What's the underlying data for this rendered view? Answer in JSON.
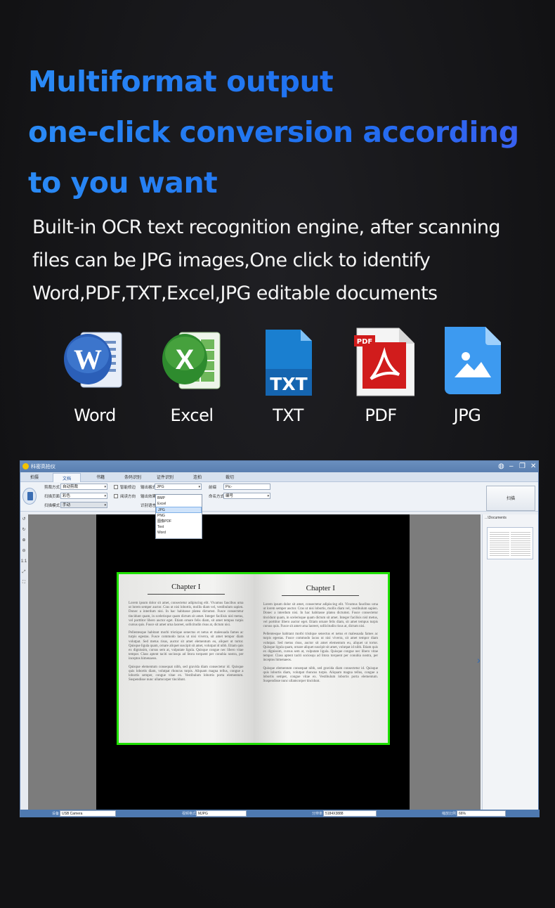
{
  "headline": {
    "line1": "Multiformat output",
    "line2": "one-click conversion according",
    "line3": "to you want"
  },
  "description": {
    "line1": "Built-in OCR text recognition engine, after scanning",
    "line2": "files can be JPG images,One click to identify",
    "line3": "Word,PDF,TXT,Excel,JPG editable documents"
  },
  "formats": [
    {
      "label": "Word",
      "icon": "word-icon",
      "color": "#2b5fb8"
    },
    {
      "label": "Excel",
      "icon": "excel-icon",
      "color": "#2e8b2e"
    },
    {
      "label": "TXT",
      "icon": "txt-icon",
      "color": "#1a7fd0",
      "glyph": "TXT"
    },
    {
      "label": "PDF",
      "icon": "pdf-icon",
      "color": "#d11c1c",
      "glyph": "PDF"
    },
    {
      "label": "JPG",
      "icon": "jpg-icon",
      "color": "#3d9af0"
    }
  ],
  "app": {
    "title": "科密高拍仪",
    "tabs": [
      "拍摄",
      "文档",
      "书籍",
      "条码识别",
      "证件识别",
      "连拍",
      "裁切"
    ],
    "active_tab": "文档",
    "ribbon": {
      "crop_label": "剪裁方式",
      "crop_value": "自动剪裁",
      "color_label": "扫描页面",
      "color_value": "彩色",
      "mode_label": "扫描模式",
      "mode_value": "手动",
      "smart_label": "智能修边",
      "rotate_label": "阅读方向",
      "output_label": "输出格式",
      "output_value": "JPG",
      "effect_label": "输出效果",
      "lang_label": "识别语言",
      "prefix_label": "前缀",
      "prefix_value": "Pic-",
      "naming_label": "命名方式",
      "naming_value": "编号"
    },
    "format_options": [
      "BMP",
      "Excel",
      "JPG",
      "PNG",
      "图像PDF",
      "Text",
      "Word"
    ],
    "selected_format": "JPG",
    "scan_button": "扫描",
    "side_panel_title": "...\\Documents",
    "left_tools": [
      "↺",
      "↻",
      "⊕",
      "⊖",
      "1:1",
      "⤢",
      "⛶"
    ],
    "book": {
      "left_heading": "Chapter I",
      "right_heading": "Chapter I",
      "para1": "Lorem ipsum dolor sit amet, consectetur adipiscing elit. Vivamus faucibus urna ut lorem semper auctor. Cras ut nisi lobortis, mollis diam vel, vestibulum sapien. Donec a interdum nisi. In hac habitasse platea dictumst. Fusce consectetur tincidunt quam, in scelerisque quam dictum sit amet. Integer facilisis nisl metus, vel porttitor libero auctor eget. Etiam ornare felis diam, sit amet tempus turpis cursus quis. Fusce sit amet urna laoreet, sollicitudin risus at, dictum nisi.",
      "para2": "Pellentesque habitant morbi tristique senectus et netus et malesuada fames ac turpis egestas. Fusce commodo lacus ut nisi viverra, sit amet tempor diam volutpat. Sed metus risus, auctor sit amet elementum eu, aliquet ut tortor. Quisque ligula quam, ornare aliquet suscipit sit amet, volutpat id nibh. Etiam quis ex dignissim, cursus sem at, vulputate ligula. Quisque congue nec libero vitae tempor. Class aptent taciti sociosqu ad litora torquent per conubia nostra, per inceptos himenaeos.",
      "para3": "Quisque elementum consequat nibh, sed gravida diam consectetur id. Quisque quis lobortis diam, volutpat rhoncus turpis. Aliquam magna tellus, congue a lobortis semper, congue vitae ex. Vestibulum lobortis porta elementum. Suspendisse nunc ullamcorper tincidunt."
    },
    "status": {
      "device_label": "设备",
      "device_value": "USB Camera",
      "format_label": "视频格式",
      "format_value": "MJPG",
      "resolution_label": "分辨率",
      "resolution_value": "5184X3888",
      "zoom_label": "缩放比例",
      "zoom_value": "66%"
    }
  }
}
